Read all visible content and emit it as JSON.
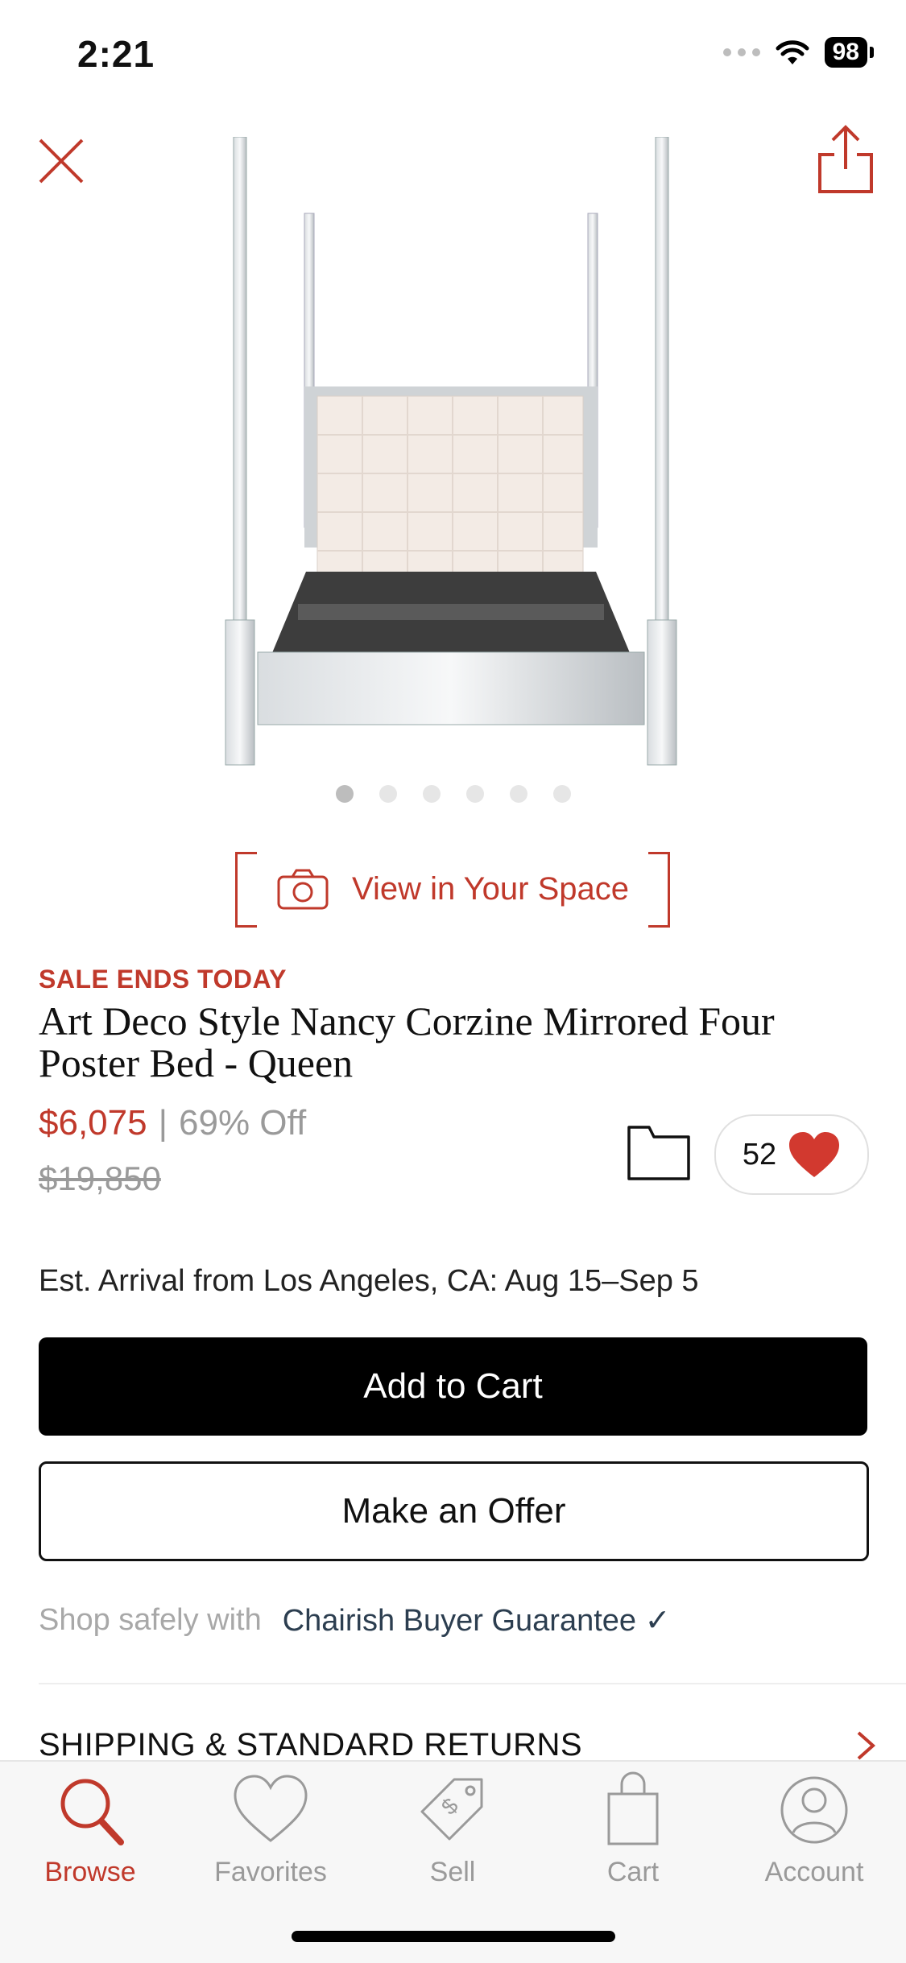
{
  "status_bar": {
    "time": "2:21",
    "battery": "98"
  },
  "product": {
    "image_count": 6,
    "active_image": 1,
    "view_in_space_label": "View in Your Space",
    "sale_label": "SALE ENDS TODAY",
    "title": "Art Deco Style Nancy Corzine Mirrored Four Poster Bed - Queen",
    "price": "$6,075",
    "separator": "|",
    "discount": "69% Off",
    "original_price": "$19,850",
    "favorites_count": "52",
    "arrival": "Est. Arrival from Los Angeles, CA: Aug 15–Sep 5"
  },
  "actions": {
    "add_to_cart": "Add to Cart",
    "make_offer": "Make an Offer"
  },
  "guarantee": {
    "prefix": "Shop safely with",
    "link": "Chairish Buyer Guarantee",
    "check": "✓"
  },
  "shipping": {
    "label": "SHIPPING & STANDARD RETURNS"
  },
  "tabs": [
    {
      "label": "Browse",
      "icon": "search-icon",
      "active": true
    },
    {
      "label": "Favorites",
      "icon": "heart-icon",
      "active": false
    },
    {
      "label": "Sell",
      "icon": "price-tag-icon",
      "active": false
    },
    {
      "label": "Cart",
      "icon": "shopping-bag-icon",
      "active": false
    },
    {
      "label": "Account",
      "icon": "user-icon",
      "active": false
    }
  ],
  "colors": {
    "accent": "#c0392b",
    "muted": "#9a9a9a",
    "link": "#2c3e50"
  }
}
